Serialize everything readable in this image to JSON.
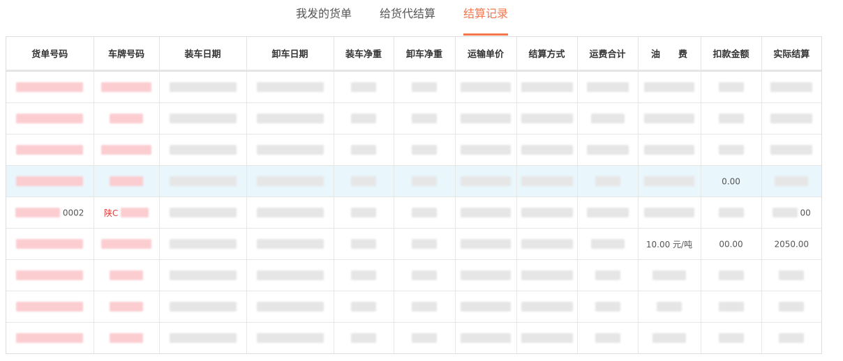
{
  "tabs": [
    {
      "label": "我发的货单",
      "active": false
    },
    {
      "label": "给货代结算",
      "active": false
    },
    {
      "label": "结算记录",
      "active": true
    }
  ],
  "table": {
    "headers": [
      "货单号码",
      "车牌号码",
      "装车日期",
      "卸车日期",
      "装车净重",
      "卸车净重",
      "运输单价",
      "结算方式",
      "运费合计",
      "油　　费",
      "扣款金额",
      "实际结算"
    ],
    "highlighted_row": 3,
    "partial_text": {
      "row4_plate": "陕C",
      "row4_order_tail": "0002",
      "row4_actual": "00",
      "row3_deduct": "0.00",
      "row5_deduct": "00.00",
      "row5_actual": "2050.00",
      "row5_fuel": "10.00 元/吨"
    }
  },
  "colors": {
    "accent": "#f4754a",
    "highlight_row": "#e9f6fc",
    "redacted_red": "#fbcdd1",
    "redacted_gray": "#e6e6e6"
  }
}
